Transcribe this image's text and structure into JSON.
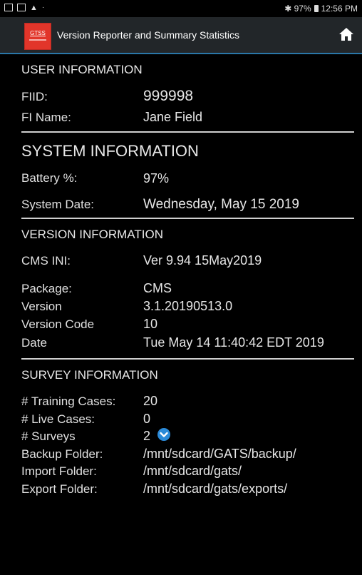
{
  "status_bar": {
    "left_icons": [
      "image-icon",
      "cast-icon",
      "warning-icon",
      "dot-icon"
    ],
    "bluetooth_battery": "✱ 97%",
    "time": "12:56 PM"
  },
  "app_bar": {
    "logo_text": "GTSS",
    "title": "Version Reporter and Summary Statistics",
    "home_icon": "home-icon",
    "colors": {
      "bar": "#222629",
      "accent": "#2a77a8",
      "logo": "#e2352a"
    }
  },
  "user_info": {
    "heading": "USER INFORMATION",
    "fiid_label": "FIID:",
    "fiid_value": "999998",
    "fi_name_label": "FI Name:",
    "fi_name_value": "Jane Field"
  },
  "system_info": {
    "heading": "SYSTEM INFORMATION",
    "battery_label": "Battery %:",
    "battery_value": "97%",
    "system_date_label": "System Date:",
    "system_date_value": "Wednesday, May 15 2019"
  },
  "version_info": {
    "heading": "VERSION INFORMATION",
    "cms_ini_label": "CMS INI:",
    "cms_ini_value": "Ver 9.94 15May2019",
    "package_label": "Package:",
    "package_value": "CMS",
    "version_label": "Version",
    "version_value": "3.1.20190513.0",
    "version_code_label": "Version Code",
    "version_code_value": "10",
    "date_label": "Date",
    "date_value": "Tue May 14 11:40:42 EDT 2019"
  },
  "survey_info": {
    "heading": "SURVEY INFORMATION",
    "training_label": "# Training Cases:",
    "training_value": "20",
    "live_label": "# Live Cases:",
    "live_value": "0",
    "surveys_label": "# Surveys",
    "surveys_value": "2",
    "backup_label": "Backup Folder:",
    "backup_value": "/mnt/sdcard/GATS/backup/",
    "import_label": "Import Folder:",
    "import_value": "/mnt/sdcard/gats/",
    "export_label": "Export Folder:",
    "export_value": "/mnt/sdcard/gats/exports/"
  }
}
